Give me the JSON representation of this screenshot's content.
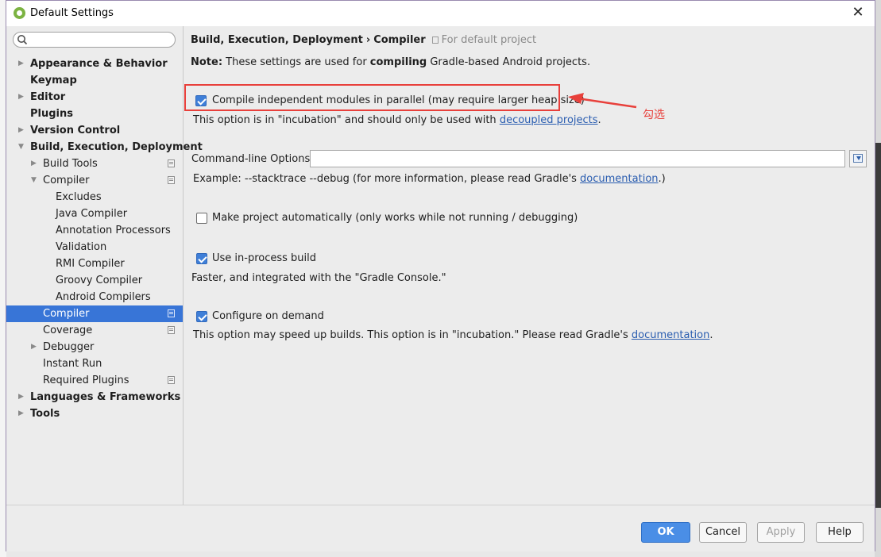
{
  "window": {
    "title": "Default Settings"
  },
  "search": {
    "placeholder": ""
  },
  "tree": [
    {
      "label": "Appearance & Behavior",
      "level": 0,
      "arrow": "right",
      "bold": true
    },
    {
      "label": "Keymap",
      "level": 0,
      "arrow": "",
      "bold": true
    },
    {
      "label": "Editor",
      "level": 0,
      "arrow": "right",
      "bold": true
    },
    {
      "label": "Plugins",
      "level": 0,
      "arrow": "",
      "bold": true
    },
    {
      "label": "Version Control",
      "level": 0,
      "arrow": "right",
      "bold": true
    },
    {
      "label": "Build, Execution, Deployment",
      "level": 0,
      "arrow": "down",
      "bold": true
    },
    {
      "label": "Build Tools",
      "level": 1,
      "arrow": "right",
      "bold": false,
      "project_icon": true
    },
    {
      "label": "Compiler",
      "level": 1,
      "arrow": "down",
      "bold": false,
      "project_icon": true
    },
    {
      "label": "Excludes",
      "level": 2,
      "arrow": "",
      "bold": false
    },
    {
      "label": "Java Compiler",
      "level": 2,
      "arrow": "",
      "bold": false
    },
    {
      "label": "Annotation Processors",
      "level": 2,
      "arrow": "",
      "bold": false
    },
    {
      "label": "Validation",
      "level": 2,
      "arrow": "",
      "bold": false
    },
    {
      "label": "RMI Compiler",
      "level": 2,
      "arrow": "",
      "bold": false
    },
    {
      "label": "Groovy Compiler",
      "level": 2,
      "arrow": "",
      "bold": false
    },
    {
      "label": "Android Compilers",
      "level": 2,
      "arrow": "",
      "bold": false
    },
    {
      "label": "Compiler",
      "level": 1,
      "arrow": "",
      "bold": false,
      "project_icon": true,
      "selected": true
    },
    {
      "label": "Coverage",
      "level": 1,
      "arrow": "",
      "bold": false,
      "project_icon": true
    },
    {
      "label": "Debugger",
      "level": 1,
      "arrow": "right",
      "bold": false
    },
    {
      "label": "Instant Run",
      "level": 1,
      "arrow": "",
      "bold": false
    },
    {
      "label": "Required Plugins",
      "level": 1,
      "arrow": "",
      "bold": false,
      "project_icon": true
    },
    {
      "label": "Languages & Frameworks",
      "level": 0,
      "arrow": "right",
      "bold": true
    },
    {
      "label": "Tools",
      "level": 0,
      "arrow": "right",
      "bold": true
    }
  ],
  "breadcrumb": {
    "part1": "Build, Execution, Deployment",
    "separator": "›",
    "part2": "Compiler",
    "project_note": "For default project"
  },
  "note": {
    "label": "Note:",
    "text1": " These settings are used for ",
    "bold_word": "compiling",
    "text2": " Gradle-based Android projects."
  },
  "options": {
    "parallel": {
      "label": "Compile independent modules in parallel (may require larger heap size)",
      "checked": true,
      "help_text": "This option is in \"incubation\" and should only be used with ",
      "help_link": "decoupled projects",
      "help_suffix": "."
    },
    "command_line": {
      "label": "Command-line Options:",
      "value": "",
      "example_text": "Example: --stacktrace --debug (for more information, please read Gradle's ",
      "example_link": "documentation",
      "example_suffix": ".)"
    },
    "make_auto": {
      "label": "Make project automatically (only works while not running / debugging)",
      "checked": false
    },
    "in_process": {
      "label": "Use in-process build",
      "checked": true,
      "help_text": "Faster, and integrated with the \"Gradle Console.\""
    },
    "on_demand": {
      "label": "Configure on demand",
      "checked": true,
      "help_text": "This option may speed up builds. This option is in \"incubation.\" Please read Gradle's ",
      "help_link": "documentation",
      "help_suffix": "."
    }
  },
  "annotation": {
    "text": "勾选",
    "color": "#e8403b"
  },
  "buttons": {
    "ok": "OK",
    "cancel": "Cancel",
    "apply": "Apply",
    "help": "Help"
  },
  "colors": {
    "selection": "#3875d7",
    "primary_button": "#4a8ee6",
    "link": "#2a5db0"
  }
}
